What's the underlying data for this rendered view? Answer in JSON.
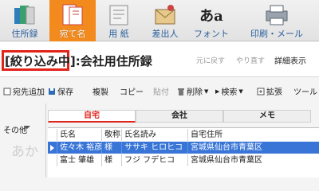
{
  "ribbon": {
    "items": [
      {
        "label": "住所録"
      },
      {
        "label": "宛て名"
      },
      {
        "label": "用 紙"
      },
      {
        "label": "差出人"
      },
      {
        "label": "フォント"
      },
      {
        "label": "印刷・メール"
      }
    ],
    "fonts_icon_text": "あa",
    "active_color": "#f28a1e"
  },
  "header": {
    "filter_tag": "[絞り込み中]",
    "title": ":会社用住所録",
    "undo": "元に戻す",
    "redo": "やり直す",
    "detail": "詳細表示"
  },
  "toolbar": {
    "add": "宛先追加",
    "save": "保存",
    "duplicate": "複製",
    "copy": "コピー",
    "paste": "貼付",
    "delete": "削除",
    "search": "検索",
    "expand": "拡張",
    "tools": "ツール"
  },
  "sidebar": {
    "other": "その他",
    "kana": "あか"
  },
  "tabs": [
    {
      "label": "自宅",
      "active": true
    },
    {
      "label": "会社",
      "active": false
    },
    {
      "label": "メモ",
      "active": false
    }
  ],
  "table": {
    "columns": [
      "氏名",
      "敬称",
      "氏名読み",
      "自宅住所"
    ],
    "rows": [
      [
        "佐々木 裕彦",
        "様",
        "ササキ ヒロヒコ",
        "宮城県仙台市青葉区"
      ],
      [
        "富士 肇雄",
        "様",
        "フジ フデヒコ",
        "宮城県仙台市青葉区"
      ]
    ]
  },
  "accent_red": "#e2231a",
  "selection_blue": "#3875d7"
}
